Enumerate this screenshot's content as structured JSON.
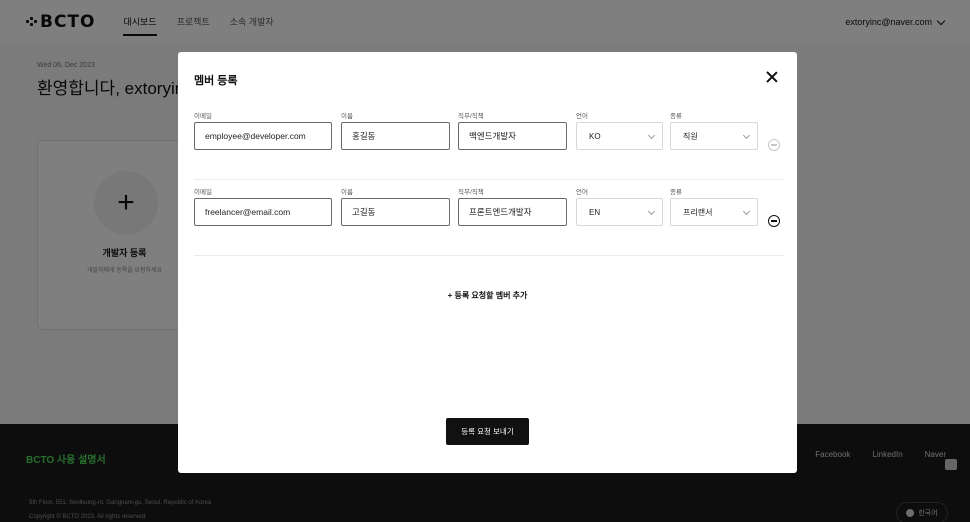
{
  "topbar": {
    "logo": "BCTO",
    "nav": [
      "대시보드",
      "프로젝트",
      "소속 개발자"
    ],
    "account": "extoryinc@naver.com"
  },
  "dashboard": {
    "date": "Wed 06, Dec 2023",
    "welcome": "환영합니다, extoryinc",
    "card_title": "개발자 등록",
    "card_subtitle": "개발자에게 등록을 요청하세요"
  },
  "footer": {
    "brand": "BCTO 사용 설명서",
    "links": [
      "Facebook",
      "LinkedIn",
      "Naver"
    ],
    "address": "5th Floor, 551, Seolleung-ro, Gangnam-gu, Seoul, Republic of Korea",
    "copyright": "Copyright © BCTO 2023. All rights reserved.",
    "language": "한국어"
  },
  "modal": {
    "title": "멤버 등록",
    "labels": {
      "email": "이메일",
      "name": "이름",
      "role": "직무/직책",
      "language": "언어",
      "type": "종류"
    },
    "rows": [
      {
        "email": "employee@developer.com",
        "name": "홍길동",
        "role": "백엔드개발자",
        "language": "KO",
        "type": "직원"
      },
      {
        "email": "freelancer@email.com",
        "name": "고길동",
        "role": "프론트엔드개발자",
        "language": "EN",
        "type": "프리랜서"
      }
    ],
    "add_member": "+ 등록 요청할 멤버 추가",
    "submit": "등록 요청 보내기"
  }
}
